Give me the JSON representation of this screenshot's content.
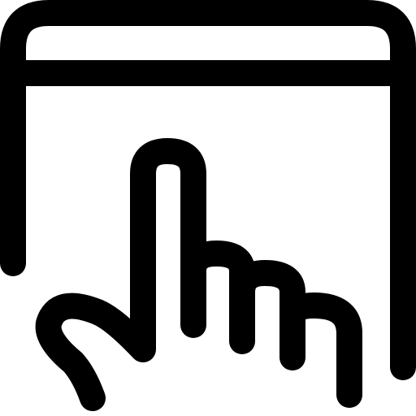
{
  "icon": {
    "name": "browser-window-tap-icon",
    "stroke_color": "#000000",
    "background_color": "#ffffff"
  }
}
